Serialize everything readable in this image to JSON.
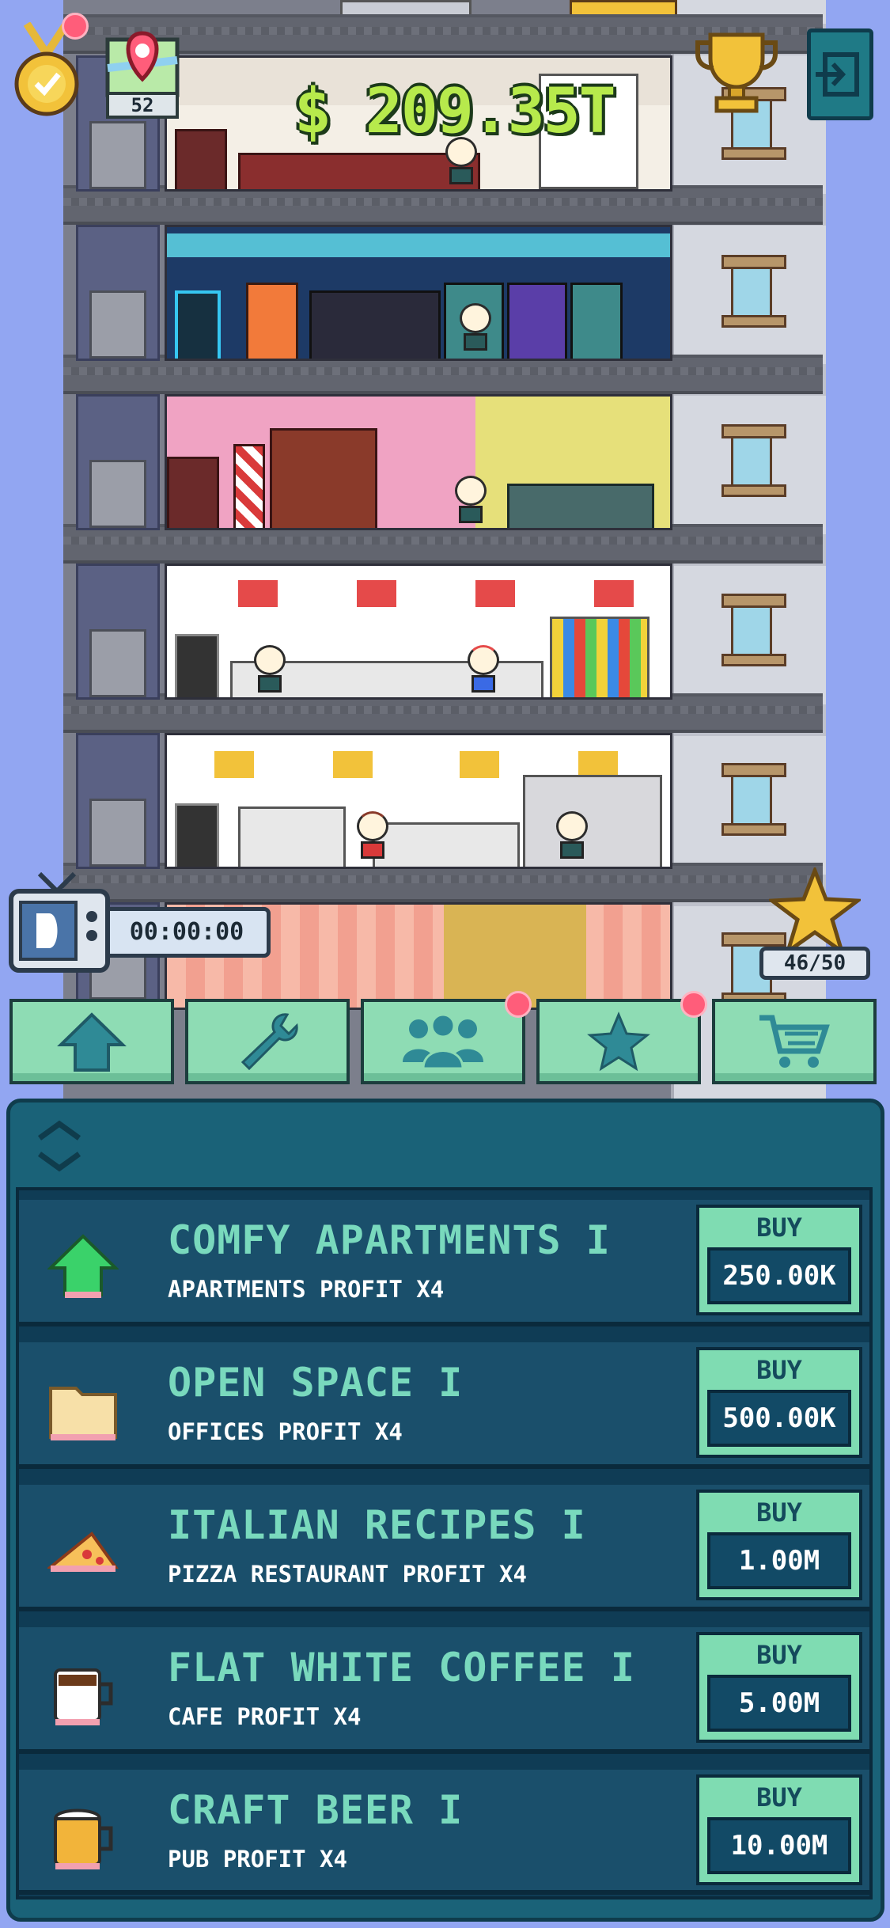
{
  "hud": {
    "money": "$ 209.35T",
    "map_level": "52",
    "timer": "00:00:00",
    "stars": "46/50"
  },
  "nav": {
    "tabs": [
      {
        "name": "home",
        "icon": "house-icon",
        "badge": false
      },
      {
        "name": "upgrades",
        "icon": "wrench-icon",
        "badge": false
      },
      {
        "name": "staff",
        "icon": "people-icon",
        "badge": true
      },
      {
        "name": "boosts",
        "icon": "star-icon",
        "badge": true
      },
      {
        "name": "shop",
        "icon": "cart-icon",
        "badge": false
      }
    ]
  },
  "upgrades": [
    {
      "name": "COMFY APARTMENTS I",
      "desc": "APARTMENTS PROFIT X4",
      "buy_label": "BUY",
      "price": "250.00K",
      "icon": "house-icon"
    },
    {
      "name": "OPEN SPACE I",
      "desc": "OFFICES PROFIT X4",
      "buy_label": "BUY",
      "price": "500.00K",
      "icon": "folder-icon"
    },
    {
      "name": "ITALIAN RECIPES I",
      "desc": "PIZZA RESTAURANT PROFIT X4",
      "buy_label": "BUY",
      "price": "1.00M",
      "icon": "pizza-icon"
    },
    {
      "name": "FLAT WHITE COFFEE I",
      "desc": "CAFE PROFIT X4",
      "buy_label": "BUY",
      "price": "5.00M",
      "icon": "coffee-icon"
    },
    {
      "name": "CRAFT BEER I",
      "desc": "PUB PROFIT X4",
      "buy_label": "BUY",
      "price": "10.00M",
      "icon": "beer-icon"
    }
  ],
  "colors": {
    "sky": "#92a6f2",
    "panel": "#1a6278",
    "row": "#1a4f6b",
    "accent_green": "#7fdcb2",
    "title_text": "#79d9bd",
    "money_text": "#b7ea4c",
    "badge": "#ff5d7a"
  }
}
